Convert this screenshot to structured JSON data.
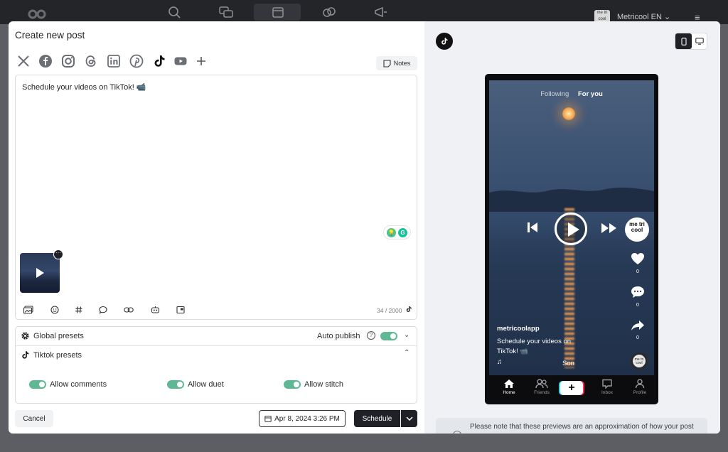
{
  "app": {
    "brand_name": "Metricool EN",
    "brand_avatar_text": "me tri cool",
    "nav_icons": [
      "analytics-icon",
      "inbox-icon",
      "planner-icon",
      "links-icon",
      "ads-icon"
    ],
    "menu_icon": "≡"
  },
  "modal": {
    "title": "Create new post",
    "networks": [
      "x-icon",
      "facebook-icon",
      "instagram-icon",
      "threads-icon",
      "linkedin-icon",
      "pinterest-icon",
      "tiktok-icon",
      "youtube-icon",
      "add-network-icon"
    ],
    "notes_label": "Notes",
    "editor": {
      "text": "Schedule your videos on TikTok! 📹",
      "counter": "34 / 2000",
      "media_more": "···"
    },
    "presets": {
      "global_label": "Global presets",
      "auto_publish_label": "Auto publish",
      "auto_publish_on": true,
      "tiktok_label": "Tiktok presets",
      "options": [
        {
          "label": "Allow comments",
          "on": true
        },
        {
          "label": "Allow duet",
          "on": true
        },
        {
          "label": "Allow stitch",
          "on": true
        }
      ]
    },
    "footer": {
      "cancel_label": "Cancel",
      "date_label": "Apr 8, 2024 3:26 PM",
      "schedule_label": "Schedule"
    }
  },
  "preview": {
    "feed_tabs": [
      "Following",
      "For you"
    ],
    "avatar_text": "me tri cool",
    "likes": "0",
    "comments": "0",
    "shares": "0",
    "username": "metricoolapp",
    "caption": "Schedule your videos on TikTok! 📹",
    "sound": "Son",
    "tabs": [
      "Home",
      "Friends",
      "Inbox",
      "Profile"
    ],
    "note": "Please note that these previews are an approximation of how your post"
  },
  "colors": {
    "toggle_on": "#5fb894",
    "primary_dark": "#1f2126",
    "preview_bg": "#eff1f4"
  }
}
